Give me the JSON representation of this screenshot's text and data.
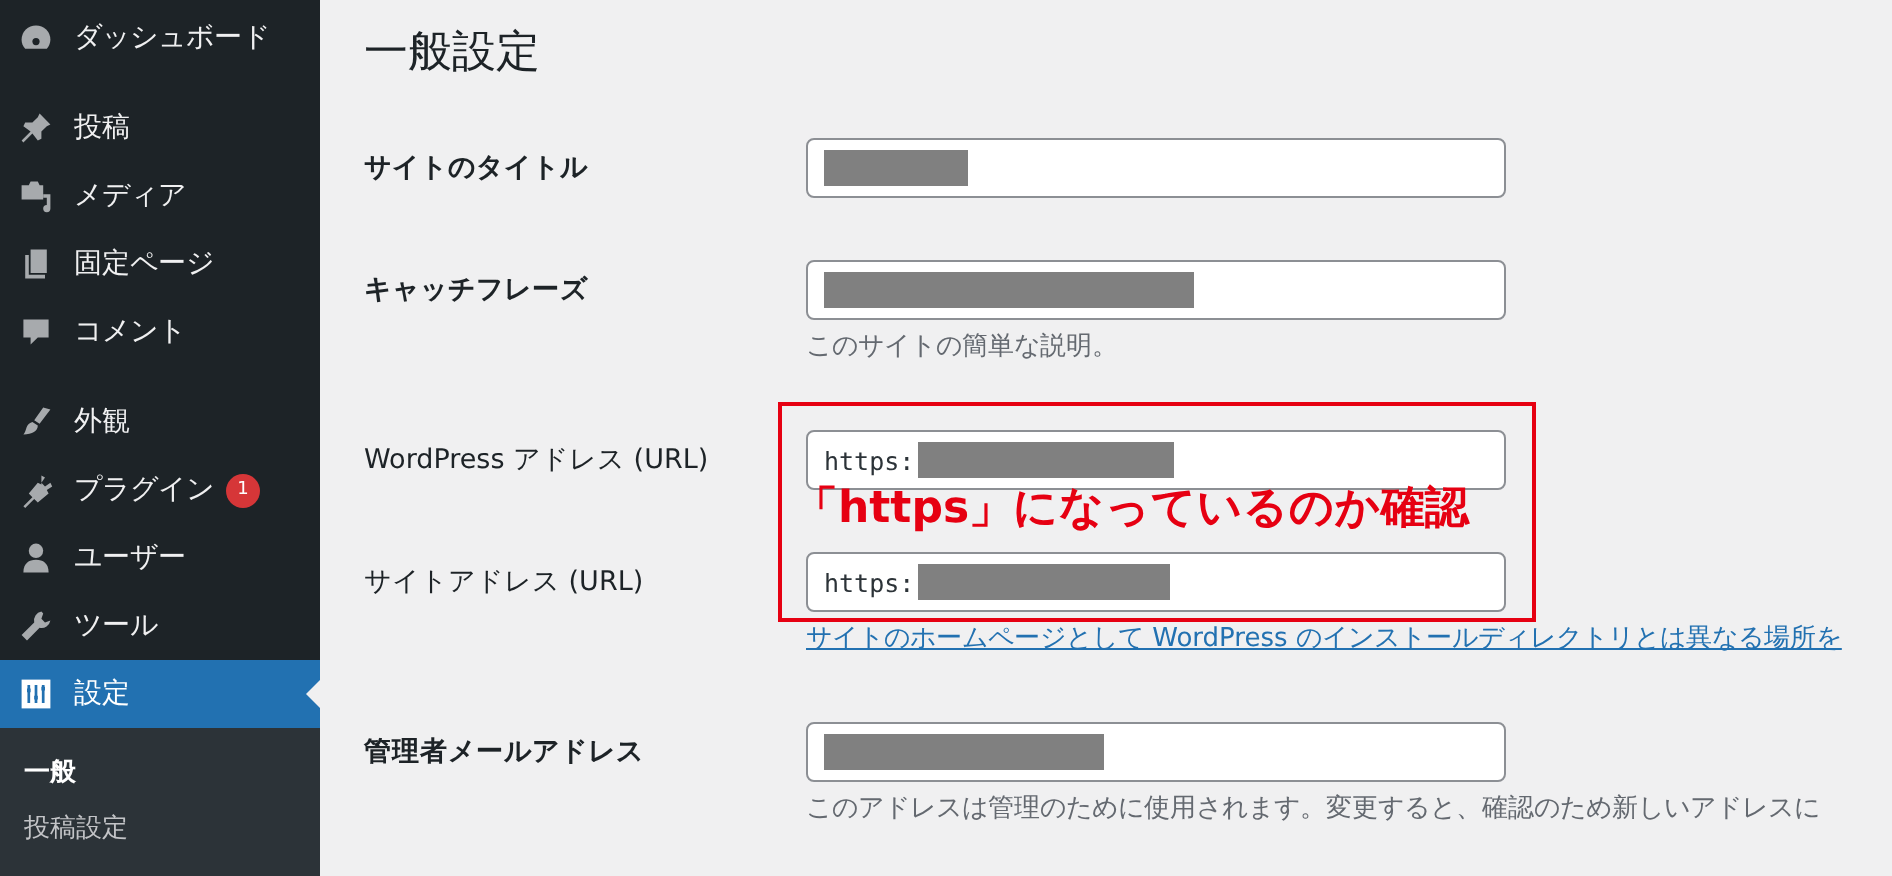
{
  "sidebar": {
    "items": [
      {
        "label": "ダッシュボード",
        "selected": false
      },
      {
        "label": "投稿",
        "selected": false
      },
      {
        "label": "メディア",
        "selected": false
      },
      {
        "label": "固定ページ",
        "selected": false
      },
      {
        "label": "コメント",
        "selected": false
      },
      {
        "label": "外観",
        "selected": false
      },
      {
        "label": "プラグイン",
        "selected": false,
        "badge": "1"
      },
      {
        "label": "ユーザー",
        "selected": false
      },
      {
        "label": "ツール",
        "selected": false
      },
      {
        "label": "設定",
        "selected": true
      }
    ],
    "submenu": [
      {
        "label": "一般",
        "selected": true
      },
      {
        "label": "投稿設定",
        "selected": false
      }
    ]
  },
  "page_title": "一般設定",
  "fields": [
    {
      "label": "サイトのタイトル",
      "bold": true,
      "redacted": true
    },
    {
      "label": "キャッチフレーズ",
      "bold": true,
      "redacted": true,
      "description": "このサイトの簡単な説明。"
    },
    {
      "label": "WordPress アドレス (URL)",
      "bold": false,
      "value": "https:",
      "redacted": true
    },
    {
      "label": "サイトアドレス (URL)",
      "bold": false,
      "value": "https:",
      "redacted": true,
      "link": "サイトのホームページとして WordPress のインストールディレクトリとは異なる場所を"
    },
    {
      "label": "管理者メールアドレス",
      "bold": true,
      "redacted": true,
      "description": "このアドレスは管理のために使用されます。変更すると、確認のため新しいアドレスに"
    }
  ],
  "annotation": {
    "text": "「https」になっているのか確認"
  }
}
